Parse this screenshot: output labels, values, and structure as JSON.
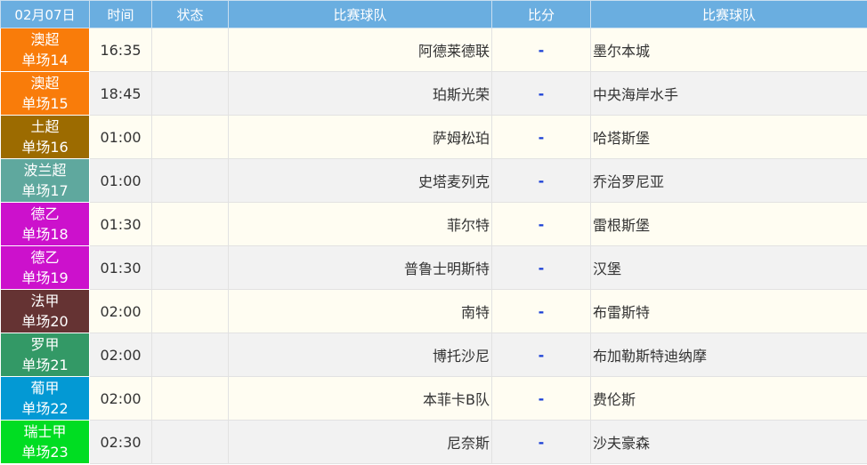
{
  "header": {
    "date": "02月07日",
    "time": "时间",
    "status": "状态",
    "home_team": "比赛球队",
    "score": "比分",
    "away_team": "比赛球队"
  },
  "matches": [
    {
      "league": "澳超",
      "match_no": "单场14",
      "league_color": "#f97c0a",
      "time": "16:35",
      "status": "",
      "home": "阿德莱德联",
      "score": "-",
      "away": "墨尔本城"
    },
    {
      "league": "澳超",
      "match_no": "单场15",
      "league_color": "#f97c0a",
      "time": "18:45",
      "status": "",
      "home": "珀斯光荣",
      "score": "-",
      "away": "中央海岸水手"
    },
    {
      "league": "土超",
      "match_no": "单场16",
      "league_color": "#9c6b00",
      "time": "01:00",
      "status": "",
      "home": "萨姆松珀",
      "score": "-",
      "away": "哈塔斯堡"
    },
    {
      "league": "波兰超",
      "match_no": "单场17",
      "league_color": "#5fa89e",
      "time": "01:00",
      "status": "",
      "home": "史塔麦列克",
      "score": "-",
      "away": "乔治罗尼亚"
    },
    {
      "league": "德乙",
      "match_no": "单场18",
      "league_color": "#cc11cc",
      "time": "01:30",
      "status": "",
      "home": "菲尔特",
      "score": "-",
      "away": "雷根斯堡"
    },
    {
      "league": "德乙",
      "match_no": "单场19",
      "league_color": "#cc11cc",
      "time": "01:30",
      "status": "",
      "home": "普鲁士明斯特",
      "score": "-",
      "away": "汉堡"
    },
    {
      "league": "法甲",
      "match_no": "单场20",
      "league_color": "#653333",
      "time": "02:00",
      "status": "",
      "home": "南特",
      "score": "-",
      "away": "布雷斯特"
    },
    {
      "league": "罗甲",
      "match_no": "单场21",
      "league_color": "#339966",
      "time": "02:00",
      "status": "",
      "home": "博托沙尼",
      "score": "-",
      "away": "布加勒斯特迪纳摩"
    },
    {
      "league": "葡甲",
      "match_no": "单场22",
      "league_color": "#0399d4",
      "time": "02:00",
      "status": "",
      "home": "本菲卡B队",
      "score": "-",
      "away": "费伦斯"
    },
    {
      "league": "瑞士甲",
      "match_no": "单场23",
      "league_color": "#00dd22",
      "time": "02:30",
      "status": "",
      "home": "尼奈斯",
      "score": "-",
      "away": "沙夫豪森"
    }
  ]
}
